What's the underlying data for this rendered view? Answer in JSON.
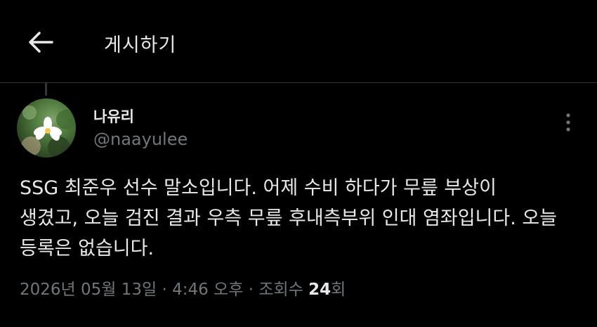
{
  "header": {
    "back_icon": "arrow-left-icon",
    "title": "게시하기"
  },
  "post": {
    "author": {
      "display_name": "나유리",
      "handle": "@naayulee"
    },
    "more_icon": "more-vertical-icon",
    "text": "SSG 최준우 선수 말소입니다. 어제 수비 하다가 무릎 부상이\n생겼고, 오늘 검진 결과 우측 무릎 후내측부위 인대 염좌입니다. 오늘\n등록은 없습니다.",
    "meta": {
      "timestamp": "2026년 05월 13일 · 4:46 오후",
      "separator": " · ",
      "views_label_prefix": "조회수 ",
      "views_count": "24",
      "views_label_suffix": "회"
    }
  },
  "colors": {
    "background": "#000000",
    "primary_text": "#e7e9ea",
    "secondary_text": "#71767b",
    "divider": "#2f3336"
  }
}
